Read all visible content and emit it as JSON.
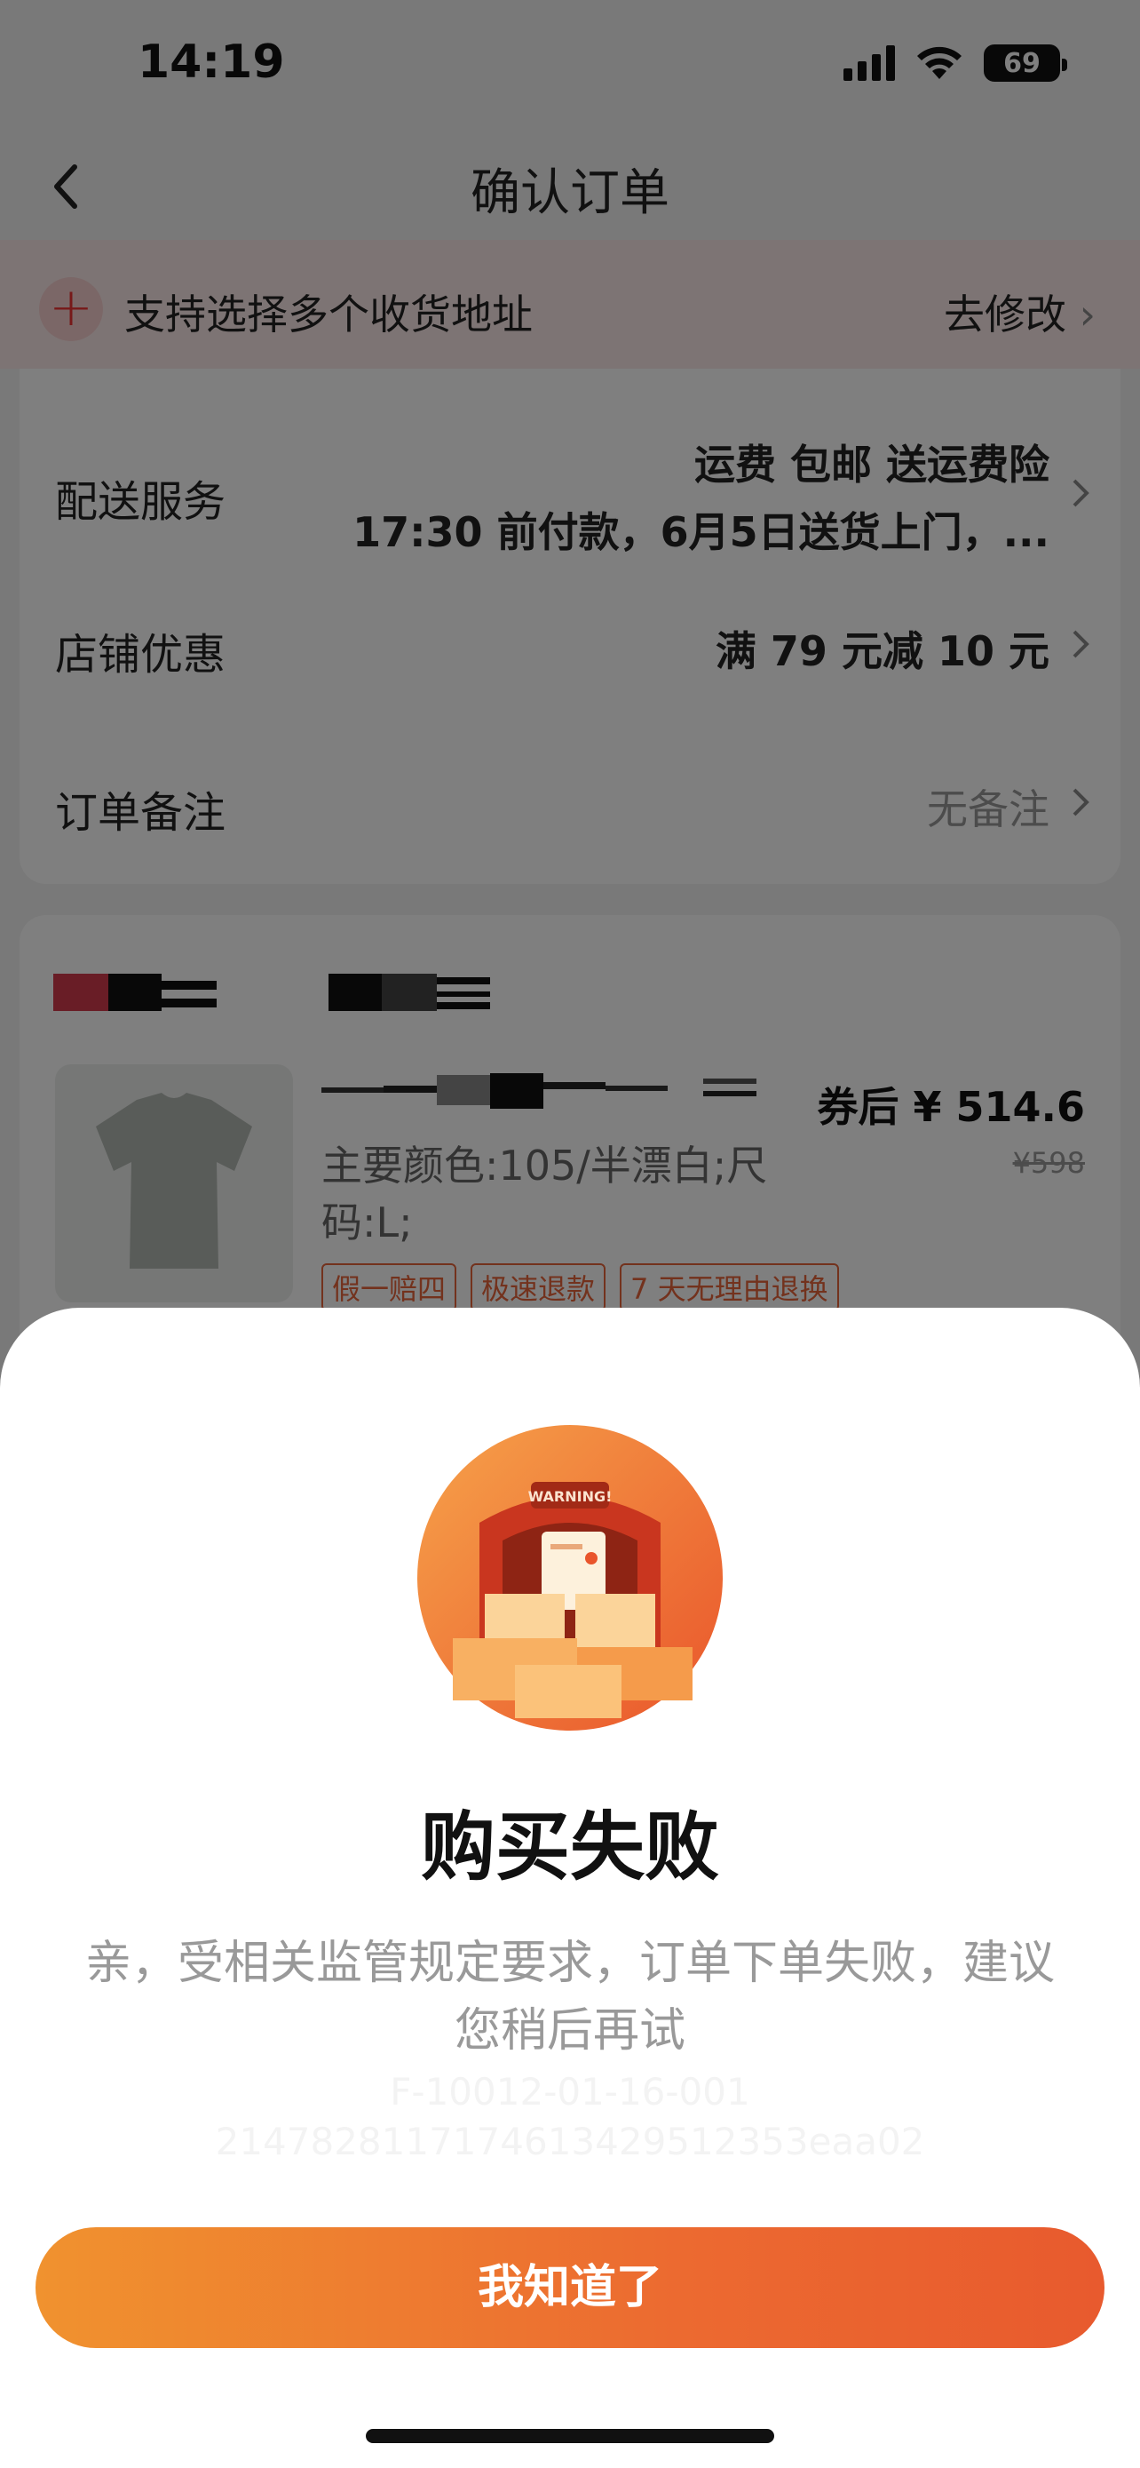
{
  "status_bar": {
    "time": "14:19",
    "battery": "69"
  },
  "nav": {
    "title": "确认订单"
  },
  "address_banner": {
    "text": "支持选择多个收货地址",
    "action": "去修改"
  },
  "order_rows": [
    {
      "label": "配送服务",
      "value_line1": "运费 包邮 送运费险",
      "value_line2": "17:30 前付款，6月5日送货上门，..."
    },
    {
      "label": "店铺优惠",
      "value": "满 79 元减 10 元"
    },
    {
      "label": "订单备注",
      "value": "无备注"
    }
  ],
  "product": {
    "coupon_price": "券后 ¥ 514.6",
    "original_price": "¥598",
    "spec": "主要颜色:105/半漂白;尺码:L;",
    "tags": [
      "假一赔四",
      "极速退款",
      "7 天无理由退换"
    ]
  },
  "dialog": {
    "title": "购买失败",
    "message": "亲，受相关监管规定要求，订单下单失败，建议您稍后再试",
    "error_code": "F-10012-01-16-001",
    "trace_id": "2147828117174613429512353eaa02",
    "button": "我知道了",
    "illustration_label": "WARNING!"
  },
  "colors": {
    "accent": "#ec6a30",
    "overlay": "rgba(0,0,0,0.5)"
  }
}
